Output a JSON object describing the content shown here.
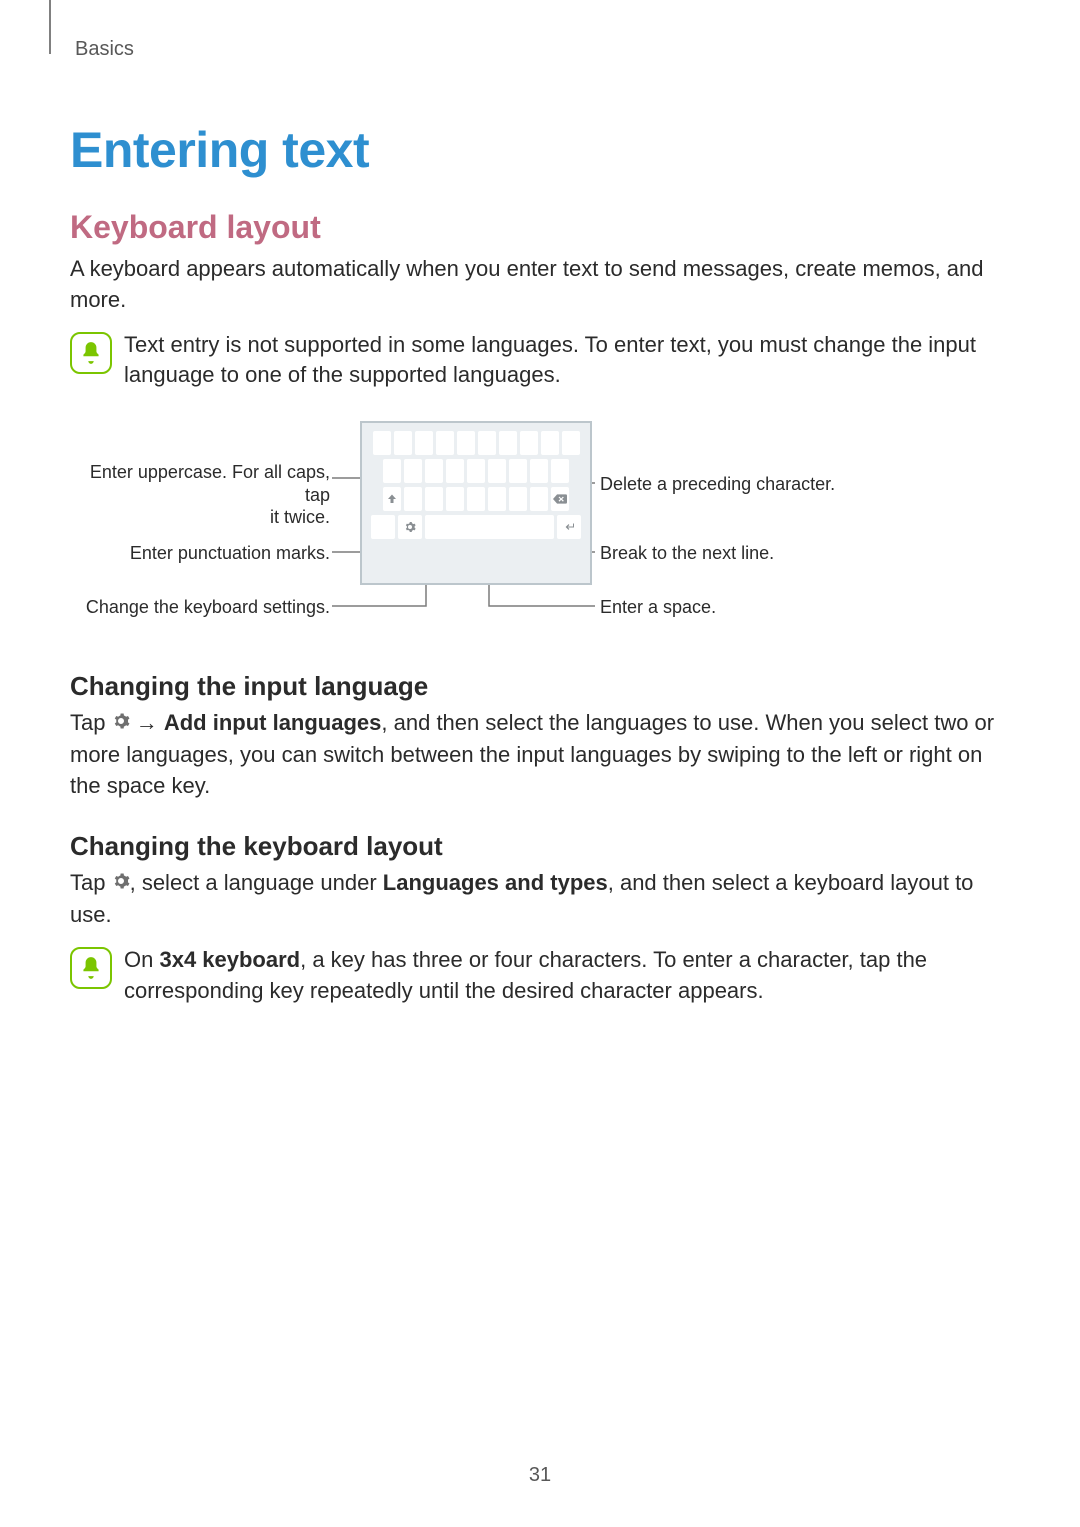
{
  "breadcrumb": "Basics",
  "title": "Entering text",
  "section1": {
    "heading": "Keyboard layout",
    "intro": "A keyboard appears automatically when you enter text to send messages, create memos, and more.",
    "note": "Text entry is not supported in some languages. To enter text, you must change the input language to one of the supported languages."
  },
  "diagram": {
    "left": {
      "shift_l1": "Enter uppercase. For all caps, tap",
      "shift_l2": "it twice.",
      "punct": "Enter punctuation marks.",
      "settings": "Change the keyboard settings."
    },
    "right": {
      "delete": "Delete a preceding character.",
      "newline": "Break to the next line.",
      "space": "Enter a space."
    }
  },
  "section2": {
    "heading": "Changing the input language",
    "para_pre": "Tap ",
    "para_arrow": " → ",
    "para_bold": "Add input languages",
    "para_post": ", and then select the languages to use. When you select two or more languages, you can switch between the input languages by swiping to the left or right on the space key."
  },
  "section3": {
    "heading": "Changing the keyboard layout",
    "para_pre": "Tap ",
    "para_mid1": ", select a language under ",
    "para_bold1": "Languages and types",
    "para_post": ", and then select a keyboard layout to use.",
    "note_pre": "On ",
    "note_bold": "3x4 keyboard",
    "note_post": ", a key has three or four characters. To enter a character, tap the corresponding key repeatedly until the desired character appears."
  },
  "page_number": "31",
  "colors": {
    "h1": "#2e8fd0",
    "h2": "#c06a82",
    "note_icon": "#7bc500",
    "leader": "#7c7c7c"
  }
}
